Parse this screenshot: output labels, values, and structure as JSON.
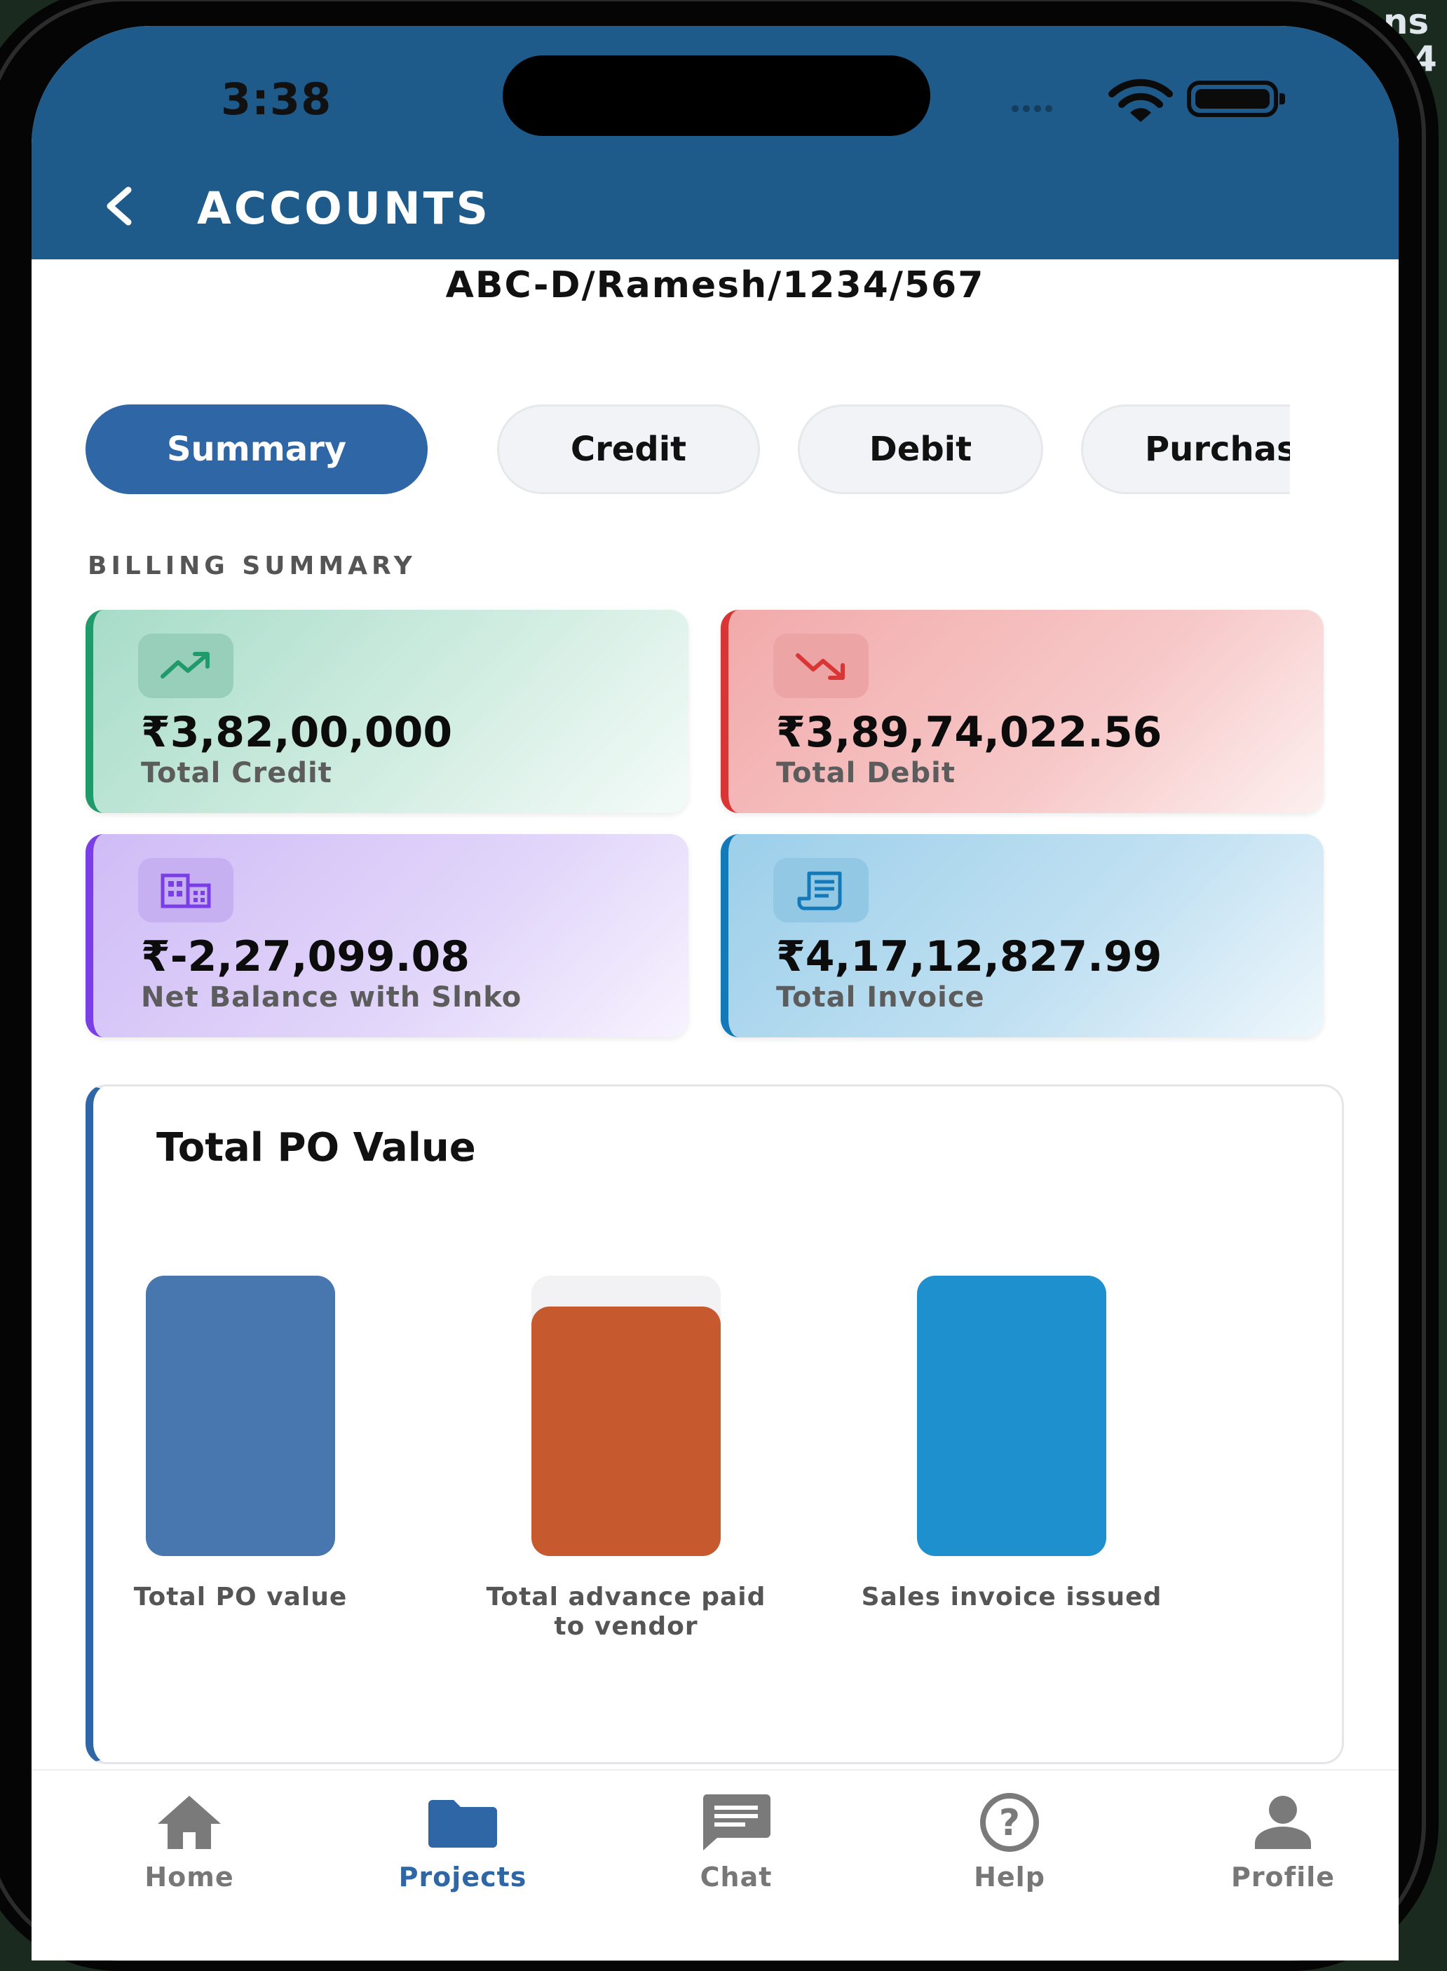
{
  "desktop": {
    "label_top": "eens",
    "label_bottom": "4"
  },
  "status_bar": {
    "time": "3:38"
  },
  "header": {
    "title": "ACCOUNTS",
    "project_id": "ABC-D/Ramesh/1234/567"
  },
  "tabs": [
    {
      "label": "Summary",
      "active": true
    },
    {
      "label": "Credit",
      "active": false
    },
    {
      "label": "Debit",
      "active": false
    },
    {
      "label": "Purchase Order",
      "active": false
    }
  ],
  "billing": {
    "section_title": "BILLING SUMMARY",
    "cards": [
      {
        "value": "₹3,82,00,000",
        "label": "Total Credit",
        "icon": "trending-up-icon",
        "accent": "#1f9a6a"
      },
      {
        "value": "₹3,89,74,022.56",
        "label": "Total Debit",
        "icon": "trending-down-icon",
        "accent": "#d93535"
      },
      {
        "value": "₹-2,27,099.08",
        "label": "Net Balance with Slnko",
        "icon": "building-icon",
        "accent": "#7a3ee6"
      },
      {
        "value": "₹4,17,12,827.99",
        "label": "Total Invoice",
        "icon": "receipt-icon",
        "accent": "#1479b8"
      }
    ]
  },
  "chart_data": {
    "type": "bar",
    "title": "Total PO Value",
    "categories": [
      "Total PO value",
      "Total advance paid to vendor",
      "Sales invoice issued"
    ],
    "values": [
      1.0,
      0.89,
      1.0
    ],
    "colors": [
      "#4876ae",
      "#c65a2e",
      "#1f90ce"
    ],
    "track_color": "#f2f2f5",
    "ylim": [
      0,
      1
    ],
    "grid": false,
    "legend": "none"
  },
  "bottom_nav": [
    {
      "label": "Home",
      "icon": "home-icon",
      "active": false
    },
    {
      "label": "Projects",
      "icon": "folder-icon",
      "active": true
    },
    {
      "label": "Chat",
      "icon": "chat-icon",
      "active": false
    },
    {
      "label": "Help",
      "icon": "help-icon",
      "active": false
    },
    {
      "label": "Profile",
      "icon": "profile-icon",
      "active": false
    }
  ],
  "colors": {
    "header": "#1e5a8a",
    "primary": "#2f66a6"
  }
}
